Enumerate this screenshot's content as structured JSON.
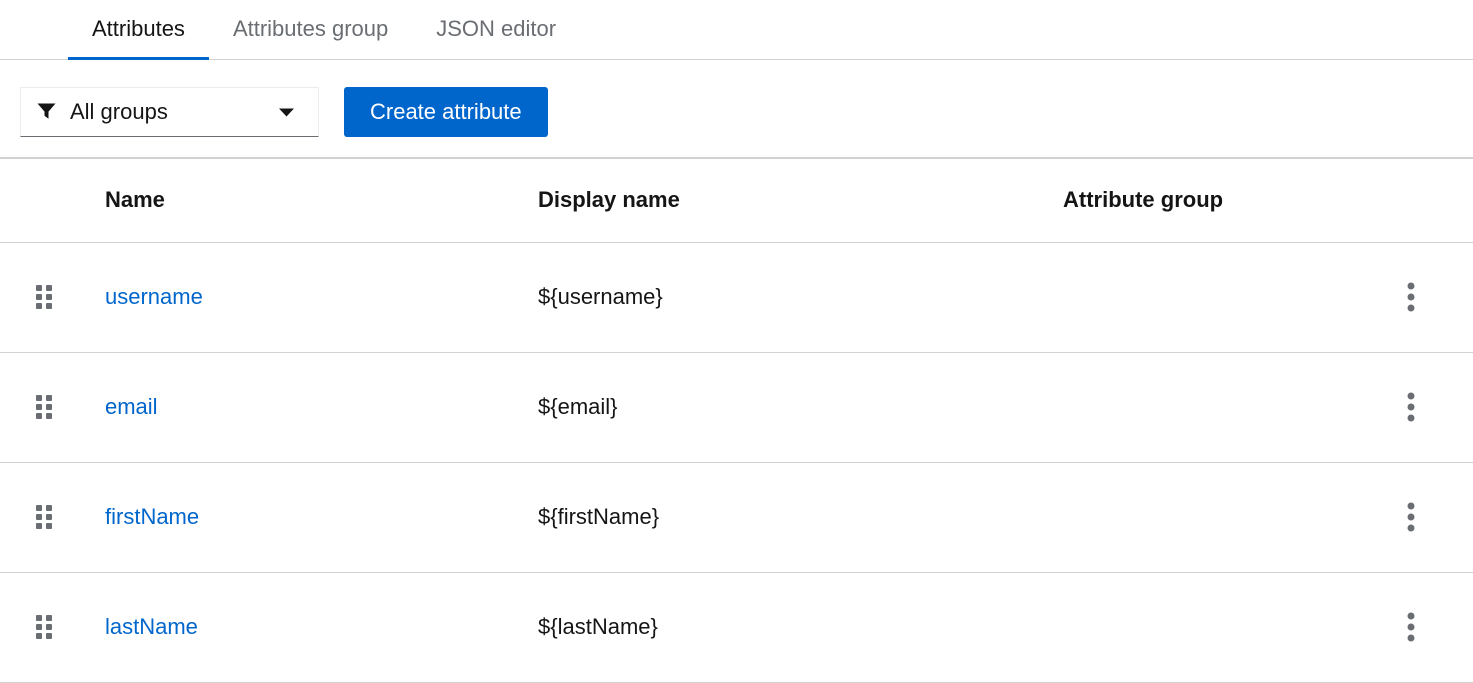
{
  "tabs": [
    {
      "label": "Attributes",
      "active": true
    },
    {
      "label": "Attributes group",
      "active": false
    },
    {
      "label": "JSON editor",
      "active": false
    }
  ],
  "toolbar": {
    "filter": {
      "selected_value": "All groups",
      "icon": "filter-funnel-icon",
      "caret_icon": "caret-down-icon"
    },
    "create_button_label": "Create attribute"
  },
  "table": {
    "columns": [
      "Name",
      "Display name",
      "Attribute group"
    ],
    "rows": [
      {
        "name": "username",
        "display_name": "${username}",
        "attribute_group": ""
      },
      {
        "name": "email",
        "display_name": "${email}",
        "attribute_group": ""
      },
      {
        "name": "firstName",
        "display_name": "${firstName}",
        "attribute_group": ""
      },
      {
        "name": "lastName",
        "display_name": "${lastName}",
        "attribute_group": ""
      }
    ],
    "row_icons": {
      "left": "grip-drag-icon",
      "right": "kebab-menu-icon"
    }
  },
  "colors": {
    "accent": "#0066cc",
    "text_primary": "#151515",
    "text_secondary": "#6a6e73",
    "border_light": "#d2d2d2",
    "icon_gray": "#6a6e73"
  }
}
